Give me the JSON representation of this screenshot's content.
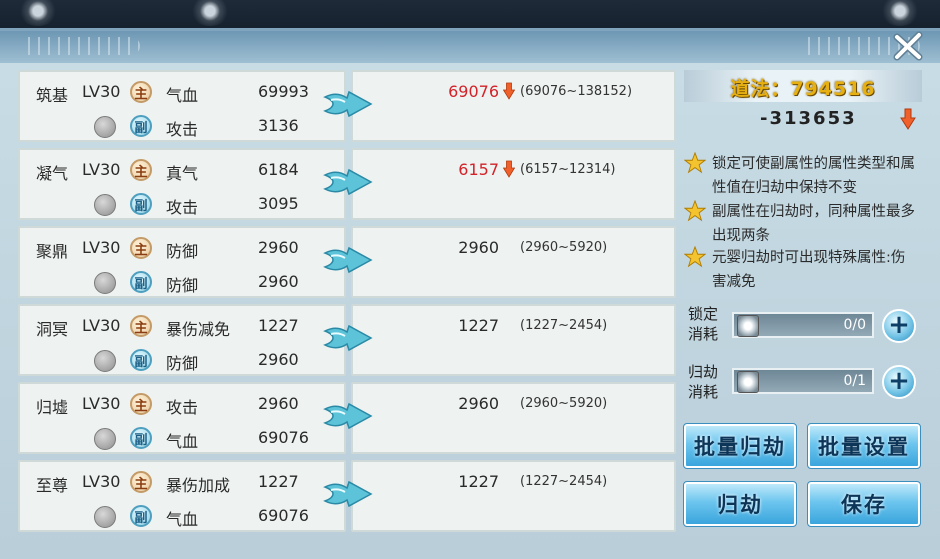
{
  "colors": {
    "value_changed": "#d2232a",
    "value_normal": "#2a2a2a",
    "dao_gold": "#e6b012",
    "down_arrow": "#f0602a",
    "button_blue": "#3aa5dc"
  },
  "header": {
    "close_icon": "close-x-icon"
  },
  "rows": [
    {
      "stage": "筑基",
      "level": "LV30",
      "main": {
        "badge": "主",
        "attr": "气血",
        "value": "69993"
      },
      "sub": {
        "badge": "副",
        "attr": "攻击",
        "value": "3136"
      },
      "result": {
        "value": "69076",
        "range": "(69076~138152)",
        "down": true
      }
    },
    {
      "stage": "凝气",
      "level": "LV30",
      "main": {
        "badge": "主",
        "attr": "真气",
        "value": "6184"
      },
      "sub": {
        "badge": "副",
        "attr": "攻击",
        "value": "3095"
      },
      "result": {
        "value": "6157",
        "range": "(6157~12314)",
        "down": true
      }
    },
    {
      "stage": "聚鼎",
      "level": "LV30",
      "main": {
        "badge": "主",
        "attr": "防御",
        "value": "2960"
      },
      "sub": {
        "badge": "副",
        "attr": "防御",
        "value": "2960"
      },
      "result": {
        "value": "2960",
        "range": "(2960~5920)",
        "down": false
      }
    },
    {
      "stage": "洞冥",
      "level": "LV30",
      "main": {
        "badge": "主",
        "attr": "暴伤减免",
        "value": "1227"
      },
      "sub": {
        "badge": "副",
        "attr": "防御",
        "value": "2960"
      },
      "result": {
        "value": "1227",
        "range": "(1227~2454)",
        "down": false
      }
    },
    {
      "stage": "归墟",
      "level": "LV30",
      "main": {
        "badge": "主",
        "attr": "攻击",
        "value": "2960"
      },
      "sub": {
        "badge": "副",
        "attr": "气血",
        "value": "69076"
      },
      "result": {
        "value": "2960",
        "range": "(2960~5920)",
        "down": false
      }
    },
    {
      "stage": "至尊",
      "level": "LV30",
      "main": {
        "badge": "主",
        "attr": "暴伤加成",
        "value": "1227"
      },
      "sub": {
        "badge": "副",
        "attr": "气血",
        "value": "69076"
      },
      "result": {
        "value": "1227",
        "range": "(1227~2454)",
        "down": false
      }
    }
  ],
  "side": {
    "dao_label": "道法：794516",
    "delta": "-313653",
    "tips": [
      "锁定可使副属性的属性类型和属性值在归劫中保持不变",
      "副属性在归劫时，同种属性最多出现两条",
      "元婴归劫时可出现特殊属性:伤害减免"
    ],
    "lock_cost": {
      "label": "锁定消耗",
      "value": "0/0"
    },
    "guijie_cost": {
      "label": "归劫消耗",
      "value": "0/1"
    },
    "buttons": {
      "batch_guijie": "批量归劫",
      "batch_settings": "批量设置",
      "guijie": "归劫",
      "save": "保存"
    }
  }
}
